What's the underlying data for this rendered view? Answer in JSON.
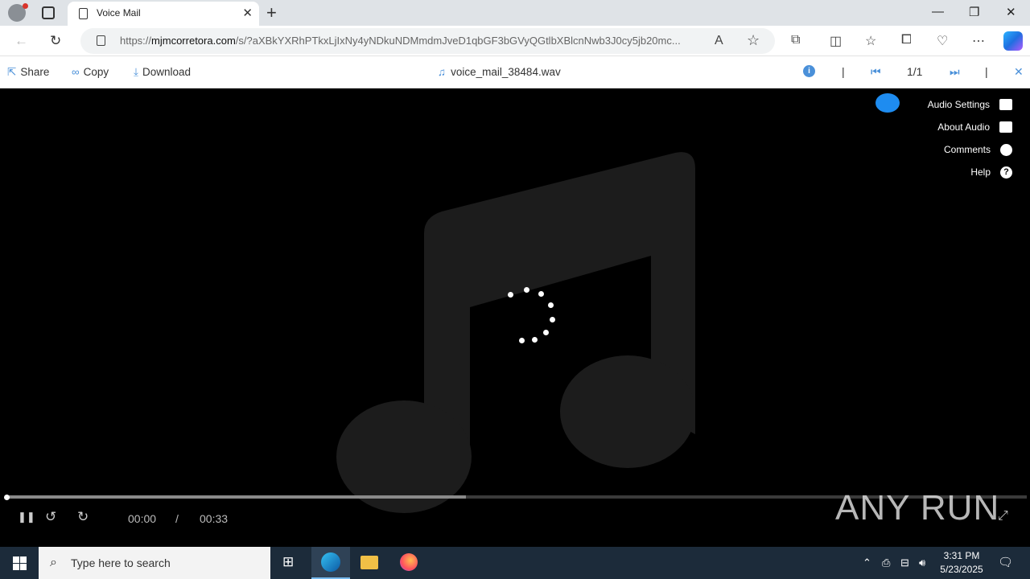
{
  "browser": {
    "tab_title": "Voice Mail",
    "url_domain": "mjmcorretora.com",
    "url_prefix": "https://",
    "url_path": "/s/?aXBkYXRhPTkxLjIxNy4yNDkuNDMmdmJveD1qbGF3bGVyQGtlbXBlcnNwb3J0cy5jb20mc..."
  },
  "viewer_toolbar": {
    "share_label": "Share",
    "copy_label": "Copy",
    "download_label": "Download",
    "file_name": "voice_mail_38484.wav",
    "page_counter": "1/1",
    "separator": "|"
  },
  "side_menu": {
    "items": [
      {
        "label": "Audio Settings",
        "icon": "settings-icon"
      },
      {
        "label": "About Audio",
        "icon": "play-icon"
      },
      {
        "label": "Comments",
        "icon": "comment-icon"
      },
      {
        "label": "Help",
        "icon": "help-icon"
      }
    ]
  },
  "player": {
    "current_time": "00:00",
    "time_separator": "/",
    "duration": "00:33",
    "played_fraction": 0,
    "buffered_fraction": 0.45
  },
  "watermark": "ANY RUN",
  "taskbar": {
    "search_placeholder": "Type here to search",
    "time": "3:31 PM",
    "date": "5/23/2025"
  },
  "colors": {
    "accent": "#4a90d9",
    "chat_bubble": "#1e8cf0",
    "taskbar": "#1c2b3a"
  }
}
